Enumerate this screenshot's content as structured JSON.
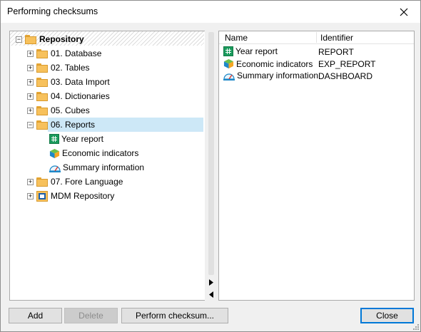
{
  "window": {
    "title": "Performing checksums"
  },
  "tree": {
    "root": "Repository",
    "items": [
      {
        "label": "01. Database"
      },
      {
        "label": "02. Tables"
      },
      {
        "label": "03. Data Import"
      },
      {
        "label": "04. Dictionaries"
      },
      {
        "label": "05. Cubes"
      },
      {
        "label": "06. Reports"
      },
      {
        "label": "Year report"
      },
      {
        "label": "Economic indicators"
      },
      {
        "label": "Summary information"
      },
      {
        "label": "07. Fore Language"
      },
      {
        "label": "MDM Repository"
      }
    ]
  },
  "list": {
    "columns": [
      "Name",
      "Identifier"
    ],
    "rows": [
      {
        "name": "Year report",
        "id": "REPORT"
      },
      {
        "name": "Economic indicators",
        "id": "EXP_REPORT"
      },
      {
        "name": "Summary information",
        "id": "DASHBOARD"
      }
    ]
  },
  "buttons": {
    "add": "Add",
    "delete": "Delete",
    "perform": "Perform checksum...",
    "close": "Close"
  },
  "colors": {
    "selection": "#cde8f7",
    "accent": "#0078d7"
  }
}
